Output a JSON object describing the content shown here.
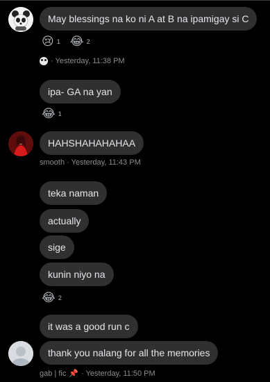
{
  "messages": [
    {
      "text": "May blessings na ko ni A at B na ipamigay si C"
    },
    {
      "text": "ipa- GA na yan"
    },
    {
      "text": "HAHSHAHAHAHAA"
    },
    {
      "text": "teka naman"
    },
    {
      "text": "actually"
    },
    {
      "text": "sige"
    },
    {
      "text": "kunin niyo na"
    },
    {
      "text": "it was a good run c"
    },
    {
      "text": "thank you nalang for all the memories"
    }
  ],
  "reactions": {
    "r1": [
      {
        "emoji": "😢",
        "count": "1"
      },
      {
        "emoji": "😂",
        "count": "2"
      }
    ],
    "r2": [
      {
        "emoji": "😂",
        "count": "1"
      }
    ],
    "r3": [
      {
        "emoji": "😂",
        "count": "2"
      }
    ]
  },
  "meta": {
    "m1": {
      "time": "· Yesterday, 11:38 PM"
    },
    "m2": {
      "text": "smooth · Yesterday, 11:43 PM"
    },
    "m3": {
      "prefix": "gab | fic",
      "pin": "📌",
      "time": "· Yesterday, 11:50 PM"
    }
  },
  "icons": {
    "avatar1": "panda-avatar",
    "avatar2": "red-dress-avatar",
    "avatar3": "blurred-avatar"
  },
  "colors": {
    "background": "#000000",
    "bubble": "#303030",
    "meta": "#8a8d91"
  }
}
